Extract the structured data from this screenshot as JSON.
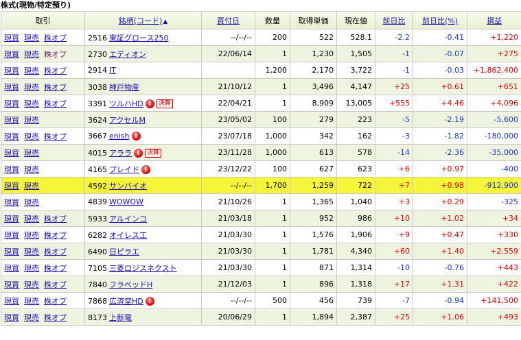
{
  "section_title": "株式(現物/特定預り)",
  "columns": {
    "trade": "取引",
    "name": "銘柄(コード)",
    "name_sort": "▲",
    "date": "買付日",
    "qty": "数量",
    "cost": "取得単価",
    "price": "現在値",
    "chg": "前日比",
    "chgp": "前日比(%)",
    "pl": "損益"
  },
  "labels": {
    "buy": "現買",
    "sell": "現売",
    "opt": "株オプ",
    "kessan": "決算",
    "alert": "!"
  },
  "rows": [
    {
      "code": "2516",
      "name": "東証グロース250",
      "date": "--/--/--",
      "qty": "200",
      "cost": "522",
      "price": "528.1",
      "chg": "-2.2",
      "chgp": "-0.41",
      "pl": "+1,220",
      "opt": "link",
      "alert": false,
      "kessan": false,
      "highlight": false
    },
    {
      "code": "2730",
      "name": "エディオン",
      "date": "22/06/14",
      "qty": "1",
      "cost": "1,230",
      "price": "1,505",
      "chg": "-1",
      "chgp": "-0.07",
      "pl": "+275",
      "opt": "plain",
      "alert": false,
      "kessan": false,
      "highlight": false
    },
    {
      "code": "2914",
      "name": "JT",
      "date": "",
      "qty": "1,200",
      "cost": "2,170",
      "price": "3,722",
      "chg": "-1",
      "chgp": "-0.03",
      "pl": "+1,862,400",
      "opt": "link",
      "alert": false,
      "kessan": false,
      "highlight": false
    },
    {
      "code": "3038",
      "name": "神戸物産",
      "date": "21/10/12",
      "qty": "1",
      "cost": "3,496",
      "price": "4,147",
      "chg": "+25",
      "chgp": "+0.61",
      "pl": "+651",
      "opt": "link",
      "alert": false,
      "kessan": false,
      "highlight": false
    },
    {
      "code": "3391",
      "name": "ツルハHD",
      "date": "22/04/21",
      "qty": "1",
      "cost": "8,909",
      "price": "13,005",
      "chg": "+555",
      "chgp": "+4.46",
      "pl": "+4,096",
      "opt": "link",
      "alert": true,
      "kessan": true,
      "highlight": false
    },
    {
      "code": "3624",
      "name": "アクセルM",
      "date": "23/05/02",
      "qty": "100",
      "cost": "279",
      "price": "223",
      "chg": "-5",
      "chgp": "-2.19",
      "pl": "-5,600",
      "opt": "none",
      "alert": false,
      "kessan": false,
      "highlight": false
    },
    {
      "code": "3667",
      "name": "enish",
      "date": "23/07/18",
      "qty": "1,000",
      "cost": "342",
      "price": "162",
      "chg": "-3",
      "chgp": "-1.82",
      "pl": "-180,000",
      "opt": "link",
      "alert": true,
      "kessan": false,
      "highlight": false
    },
    {
      "code": "4015",
      "name": "アララ",
      "date": "23/11/28",
      "qty": "1,000",
      "cost": "613",
      "price": "578",
      "chg": "-14",
      "chgp": "-2.36",
      "pl": "-35,000",
      "opt": "none",
      "alert": true,
      "kessan": true,
      "highlight": false
    },
    {
      "code": "4165",
      "name": "プレイド",
      "date": "23/12/22",
      "qty": "100",
      "cost": "627",
      "price": "623",
      "chg": "+6",
      "chgp": "+0.97",
      "pl": "-400",
      "opt": "none",
      "alert": true,
      "kessan": false,
      "highlight": false
    },
    {
      "code": "4592",
      "name": "サンバイオ",
      "date": "--/--/--",
      "qty": "1,700",
      "cost": "1,259",
      "price": "722",
      "chg": "+7",
      "chgp": "+0.98",
      "pl": "-912,900",
      "opt": "none",
      "alert": false,
      "kessan": false,
      "highlight": true
    },
    {
      "code": "4839",
      "name": "WOWOW",
      "date": "21/10/26",
      "qty": "1",
      "cost": "1,365",
      "price": "1,040",
      "chg": "+3",
      "chgp": "+0.29",
      "pl": "-325",
      "opt": "none",
      "alert": false,
      "kessan": false,
      "highlight": false
    },
    {
      "code": "5933",
      "name": "アルインコ",
      "date": "21/03/18",
      "qty": "1",
      "cost": "952",
      "price": "986",
      "chg": "+10",
      "chgp": "+1.02",
      "pl": "+34",
      "opt": "link",
      "alert": false,
      "kessan": false,
      "highlight": false
    },
    {
      "code": "6282",
      "name": "オイレス工",
      "date": "21/03/30",
      "qty": "1",
      "cost": "1,576",
      "price": "1,906",
      "chg": "+9",
      "chgp": "+0.47",
      "pl": "+330",
      "opt": "link",
      "alert": false,
      "kessan": false,
      "highlight": false
    },
    {
      "code": "6490",
      "name": "日ピラエ",
      "date": "21/03/30",
      "qty": "1",
      "cost": "1,781",
      "price": "4,340",
      "chg": "+60",
      "chgp": "+1.40",
      "pl": "+2,559",
      "opt": "link",
      "alert": false,
      "kessan": false,
      "highlight": false
    },
    {
      "code": "7105",
      "name": "三菱ロジスネクスト",
      "date": "21/03/30",
      "qty": "1",
      "cost": "871",
      "price": "1,314",
      "chg": "-10",
      "chgp": "-0.76",
      "pl": "+443",
      "opt": "link",
      "alert": false,
      "kessan": false,
      "highlight": false
    },
    {
      "code": "7840",
      "name": "フラベッドH",
      "date": "21/12/03",
      "qty": "1",
      "cost": "896",
      "price": "1,318",
      "chg": "+17",
      "chgp": "+1.31",
      "pl": "+422",
      "opt": "link",
      "alert": false,
      "kessan": false,
      "highlight": false
    },
    {
      "code": "7868",
      "name": "広済堂HD",
      "date": "--/--/--",
      "qty": "500",
      "cost": "456",
      "price": "739",
      "chg": "-7",
      "chgp": "-0.94",
      "pl": "+141,500",
      "opt": "link",
      "alert": true,
      "kessan": false,
      "highlight": false
    },
    {
      "code": "8173",
      "name": "上新電",
      "date": "20/06/29",
      "qty": "1",
      "cost": "1,894",
      "price": "2,387",
      "chg": "+25",
      "chgp": "+1.06",
      "pl": "+493",
      "opt": "link",
      "alert": false,
      "kessan": false,
      "highlight": false
    }
  ]
}
